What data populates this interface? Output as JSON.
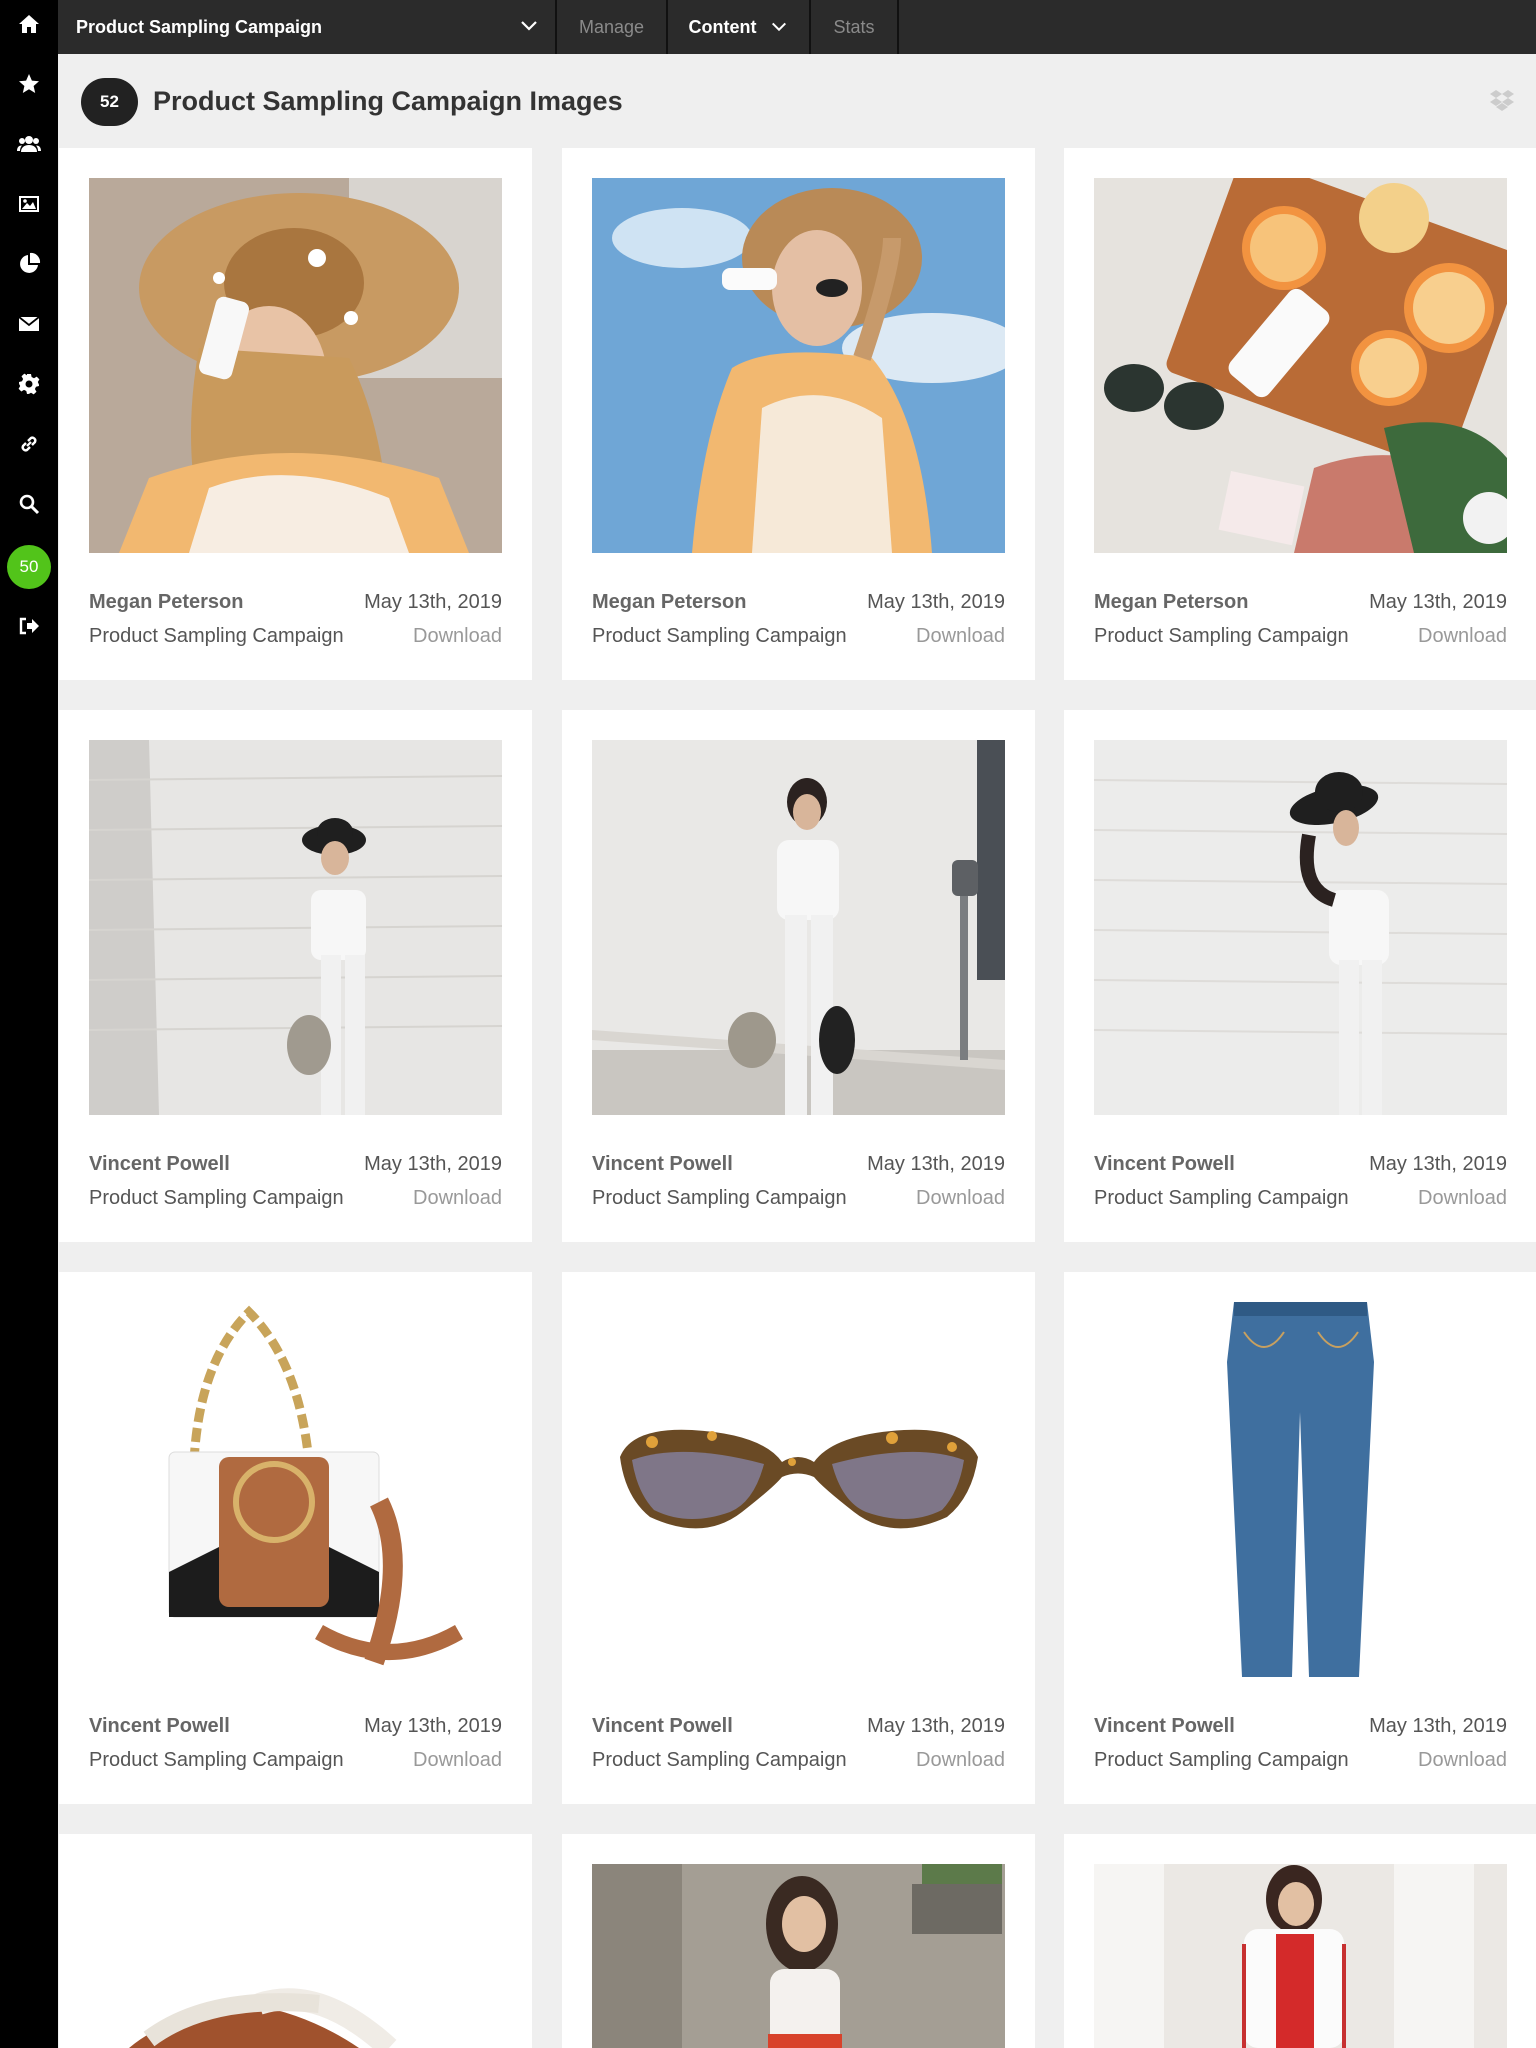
{
  "topbar": {
    "campaign": "Product Sampling Campaign",
    "tabs": [
      {
        "label": "Manage",
        "active": false
      },
      {
        "label": "Content",
        "active": true
      },
      {
        "label": "Stats",
        "active": false
      }
    ]
  },
  "rail": {
    "icons": [
      "home-icon",
      "star-icon",
      "users-icon",
      "image-icon",
      "pie-chart-icon",
      "envelope-icon",
      "gear-icon",
      "link-icon",
      "search-icon",
      "notifications-badge",
      "logout-icon"
    ],
    "badge": "50",
    "badge_color": "#52c41a"
  },
  "header": {
    "count": "52",
    "title": "Product Sampling Campaign Images"
  },
  "cards": [
    {
      "creator": "Megan Peterson",
      "date": "May 13th, 2019",
      "campaign": "Product Sampling Campaign",
      "action": "Download",
      "image": "woman-straw-hat-sunscreen"
    },
    {
      "creator": "Megan Peterson",
      "date": "May 13th, 2019",
      "campaign": "Product Sampling Campaign",
      "action": "Download",
      "image": "woman-hat-blue-sky"
    },
    {
      "creator": "Megan Peterson",
      "date": "May 13th, 2019",
      "campaign": "Product Sampling Campaign",
      "action": "Download",
      "image": "oranges-flatlay"
    },
    {
      "creator": "Vincent Powell",
      "date": "May 13th, 2019",
      "campaign": "Product Sampling Campaign",
      "action": "Download",
      "image": "woman-white-brick-wall"
    },
    {
      "creator": "Vincent Powell",
      "date": "May 13th, 2019",
      "campaign": "Product Sampling Campaign",
      "action": "Download",
      "image": "woman-street-parking-meter"
    },
    {
      "creator": "Vincent Powell",
      "date": "May 13th, 2019",
      "campaign": "Product Sampling Campaign",
      "action": "Download",
      "image": "woman-black-hat-profile"
    },
    {
      "creator": "Vincent Powell",
      "date": "May 13th, 2019",
      "campaign": "Product Sampling Campaign",
      "action": "Download",
      "image": "handbag-product"
    },
    {
      "creator": "Vincent Powell",
      "date": "May 13th, 2019",
      "campaign": "Product Sampling Campaign",
      "action": "Download",
      "image": "sunglasses-product"
    },
    {
      "creator": "Vincent Powell",
      "date": "May 13th, 2019",
      "campaign": "Product Sampling Campaign",
      "action": "Download",
      "image": "jeans-product"
    },
    {
      "creator": "",
      "date": "",
      "campaign": "",
      "action": "",
      "image": "sandal-product"
    },
    {
      "creator": "",
      "date": "",
      "campaign": "",
      "action": "",
      "image": "woman-street-red-skirt"
    },
    {
      "creator": "",
      "date": "",
      "campaign": "",
      "action": "",
      "image": "woman-white-jacket-columns"
    }
  ]
}
